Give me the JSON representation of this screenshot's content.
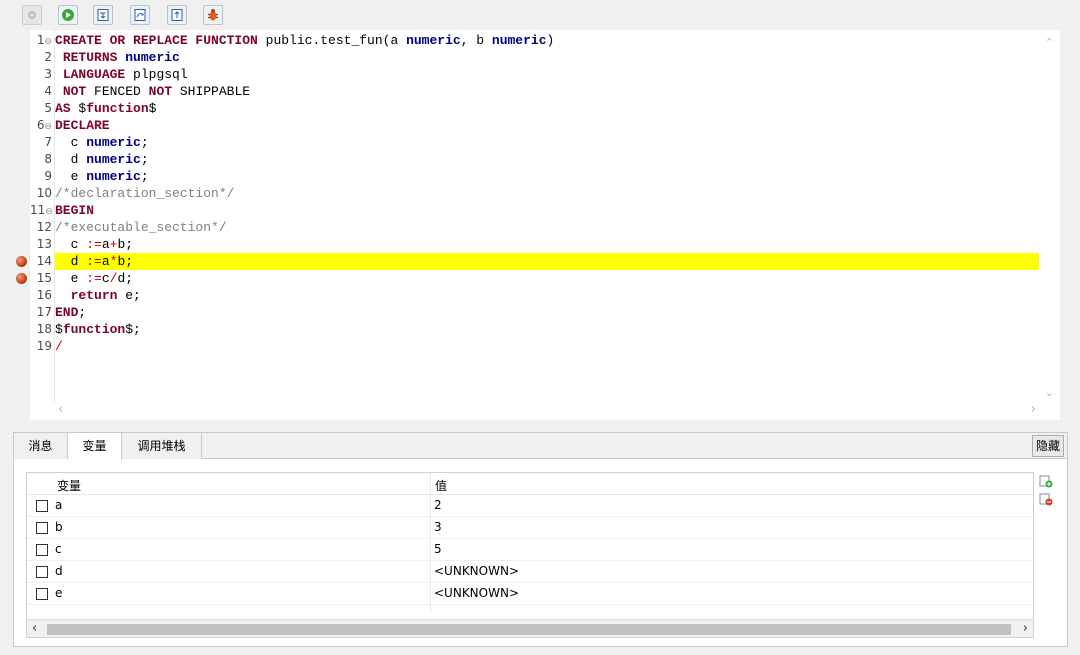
{
  "toolbar": {
    "buttons": [
      {
        "icon": "settings-icon",
        "state": "disabled"
      },
      {
        "icon": "run-icon"
      },
      {
        "icon": "step-into-icon"
      },
      {
        "icon": "step-over-icon"
      },
      {
        "icon": "step-out-icon"
      },
      {
        "icon": "debug-bug-icon"
      }
    ]
  },
  "editor": {
    "lines": [
      {
        "n": "1",
        "fold": "⊖",
        "tokens": [
          [
            "kw",
            "CREATE OR REPLACE FUNCTION"
          ],
          [
            "pl",
            " public.test_fun(a "
          ],
          [
            "ty",
            "numeric"
          ],
          [
            "pl",
            ", b "
          ],
          [
            "ty",
            "numeric"
          ],
          [
            "pl",
            ")"
          ]
        ]
      },
      {
        "n": "2",
        "tokens": [
          [
            "pl",
            " "
          ],
          [
            "kw",
            "RETURNS"
          ],
          [
            "pl",
            " "
          ],
          [
            "ty",
            "numeric"
          ]
        ]
      },
      {
        "n": "3",
        "tokens": [
          [
            "pl",
            " "
          ],
          [
            "kw",
            "LANGUAGE"
          ],
          [
            "pl",
            " plpgsql"
          ]
        ]
      },
      {
        "n": "4",
        "tokens": [
          [
            "pl",
            " "
          ],
          [
            "kw",
            "NOT"
          ],
          [
            "pl",
            " FENCED "
          ],
          [
            "kw",
            "NOT"
          ],
          [
            "pl",
            " SHIPPABLE"
          ]
        ]
      },
      {
        "n": "5",
        "tokens": [
          [
            "kw",
            "AS"
          ],
          [
            "pl",
            " $"
          ],
          [
            "kw",
            "function"
          ],
          [
            "pl",
            "$"
          ]
        ]
      },
      {
        "n": "6",
        "fold": "⊖",
        "tokens": [
          [
            "kw",
            "DECLARE"
          ]
        ]
      },
      {
        "n": "7",
        "tokens": [
          [
            "pl",
            "  c "
          ],
          [
            "ty",
            "numeric"
          ],
          [
            "pl",
            ";"
          ]
        ]
      },
      {
        "n": "8",
        "tokens": [
          [
            "pl",
            "  d "
          ],
          [
            "ty",
            "numeric"
          ],
          [
            "pl",
            ";"
          ]
        ]
      },
      {
        "n": "9",
        "tokens": [
          [
            "pl",
            "  e "
          ],
          [
            "ty",
            "numeric"
          ],
          [
            "pl",
            ";"
          ]
        ]
      },
      {
        "n": "10",
        "tokens": [
          [
            "cm",
            "/*declaration_section*/"
          ]
        ]
      },
      {
        "n": "11",
        "fold": "⊖",
        "tokens": [
          [
            "kw",
            "BEGIN"
          ]
        ]
      },
      {
        "n": "12",
        "tokens": [
          [
            "cm",
            "/*executable_section*/"
          ]
        ]
      },
      {
        "n": "13",
        "tokens": [
          [
            "pl",
            "  c "
          ],
          [
            "op",
            ":="
          ],
          [
            "pl",
            "a"
          ],
          [
            "op",
            "+"
          ],
          [
            "pl",
            "b;"
          ]
        ]
      },
      {
        "n": "14",
        "bp": true,
        "hl": true,
        "tokens": [
          [
            "pl",
            "  d "
          ],
          [
            "op",
            ":="
          ],
          [
            "pl",
            "a"
          ],
          [
            "op",
            "*"
          ],
          [
            "pl",
            "b;"
          ]
        ]
      },
      {
        "n": "15",
        "bp": true,
        "tokens": [
          [
            "pl",
            "  e "
          ],
          [
            "op",
            ":="
          ],
          [
            "pl",
            "c"
          ],
          [
            "op",
            "/"
          ],
          [
            "pl",
            "d;"
          ]
        ]
      },
      {
        "n": "16",
        "tokens": [
          [
            "pl",
            "  "
          ],
          [
            "kw",
            "return"
          ],
          [
            "pl",
            " e;"
          ]
        ]
      },
      {
        "n": "17",
        "tokens": [
          [
            "kw",
            "END"
          ],
          [
            "pl",
            ";"
          ]
        ]
      },
      {
        "n": "18",
        "tokens": [
          [
            "pl",
            "$"
          ],
          [
            "kw",
            "function"
          ],
          [
            "pl",
            "$;"
          ]
        ]
      },
      {
        "n": "19",
        "tokens": [
          [
            "op",
            "/"
          ]
        ]
      }
    ]
  },
  "panel": {
    "tabs": [
      {
        "label": "消息",
        "active": false
      },
      {
        "label": "变量",
        "active": true
      },
      {
        "label": "调用堆栈",
        "active": false
      }
    ],
    "hide_label": "隐藏",
    "columns": {
      "name": "变量",
      "value": "值"
    },
    "rows": [
      {
        "name": "a",
        "value": "2"
      },
      {
        "name": "b",
        "value": "3"
      },
      {
        "name": "c",
        "value": "5"
      },
      {
        "name": "d",
        "value": "<UNKNOWN>"
      },
      {
        "name": "e",
        "value": "<UNKNOWN>"
      }
    ],
    "side_icons": [
      "add-watch-icon",
      "remove-watch-icon"
    ]
  },
  "colors": {
    "highlight": "#ffff00",
    "keyword": "#7f0033",
    "type": "#000080",
    "comment": "#808080",
    "operator": "#d00000",
    "breakpoint": "#b3330c"
  }
}
